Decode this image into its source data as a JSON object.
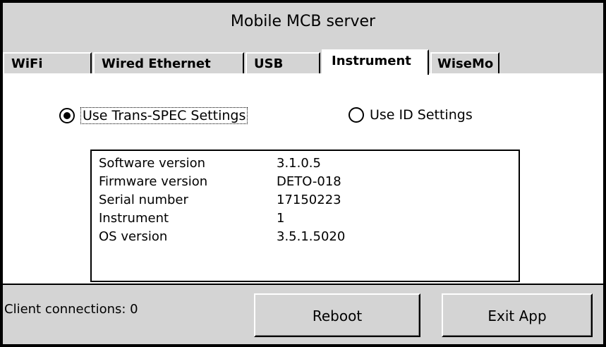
{
  "window": {
    "title": "Mobile MCB server"
  },
  "tabs": [
    {
      "label": "WiFi",
      "active": false
    },
    {
      "label": "Wired Ethernet",
      "active": false
    },
    {
      "label": "USB",
      "active": false
    },
    {
      "label": "Instrument",
      "active": true
    },
    {
      "label": "WiseMo",
      "active": false
    }
  ],
  "settings": {
    "options": [
      {
        "label": "Use Trans-SPEC Settings",
        "selected": true
      },
      {
        "label": "Use ID Settings",
        "selected": false
      }
    ]
  },
  "info": [
    {
      "key": "Software version",
      "value": "3.1.0.5"
    },
    {
      "key": "Firmware version",
      "value": "DETO-018"
    },
    {
      "key": "Serial number",
      "value": "17150223"
    },
    {
      "key": "Instrument",
      "value": "1"
    },
    {
      "key": "OS version",
      "value": "3.5.1.5020"
    }
  ],
  "footer": {
    "client_connections": "Client connections: 0",
    "reboot_label": "Reboot",
    "exit_label": "Exit App"
  }
}
